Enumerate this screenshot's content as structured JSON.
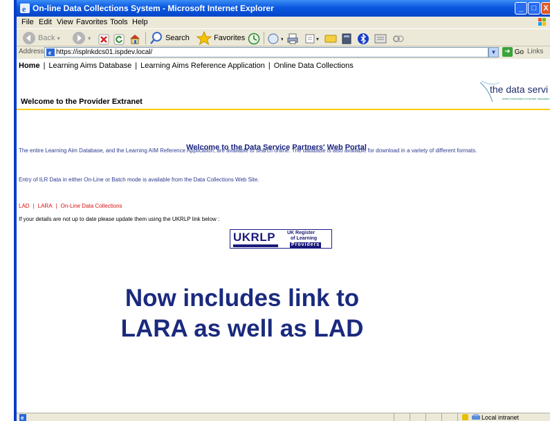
{
  "window": {
    "title": "On-line Data Collections System - Microsoft Internet Explorer",
    "controls": {
      "minimize": "_",
      "maximize": "□",
      "close": "X"
    }
  },
  "menu": [
    "File",
    "Edit",
    "View",
    "Favorites",
    "Tools",
    "Help"
  ],
  "toolbar": {
    "back_label": "Back",
    "search_label": "Search",
    "favorites_label": "Favorites"
  },
  "address": {
    "label": "Address",
    "url": "https://isplnkdcs01.ispdev.local/",
    "go_label": "Go",
    "links_label": "Links"
  },
  "page": {
    "nav": [
      "Home",
      "Learning Aims Database",
      "Learning Aims Reference Application",
      "Online Data Collections"
    ],
    "nav_separator": "|",
    "brand_text": "the data servi",
    "brand_tagline": "better information for further education",
    "extranet_title": "Welcome to the Provider Extranet",
    "portal_title": "Welcome to the Data Service Partners' Web Portal",
    "para1": "The entire Learning Aim Database, and the Learning AIM Reference Application, are available to search online. The database is also available for download in a variety of different formats.",
    "para2": "Entry of ILR Data in either On-Line or Batch mode is available from the Data Collections Web Site.",
    "quick_links": [
      "LAD",
      "LARA",
      "On-Line Data Collections"
    ],
    "update_note": "If your details are not up to date please update them using the UKRLP link below :",
    "ukrlp": {
      "acronym": "UKRLP",
      "line1": "UK Register",
      "line2": "of Learning",
      "line3": "Providers"
    }
  },
  "overlay": {
    "line1": "Now includes link to",
    "line2": "LARA as well as LAD"
  },
  "status": {
    "zone": "Local intranet"
  },
  "colors": {
    "titlebar": "#0a58e0",
    "chrome": "#ece9d8",
    "rule": "#ffcc00",
    "link_red": "#d51010",
    "navy": "#1a237e"
  }
}
